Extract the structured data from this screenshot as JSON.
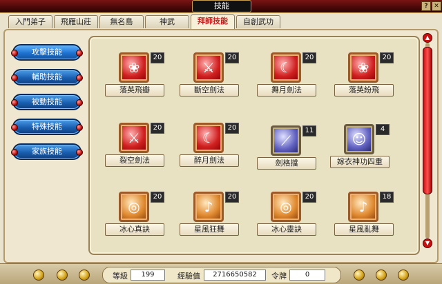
{
  "window": {
    "title": "技能"
  },
  "tabs": [
    {
      "label": "入門弟子",
      "active": false
    },
    {
      "label": "飛雁山莊",
      "active": false
    },
    {
      "label": "無名島",
      "active": false
    },
    {
      "label": "神武",
      "active": false
    },
    {
      "label": "拜師技能",
      "active": true
    },
    {
      "label": "自創武功",
      "active": false
    }
  ],
  "nav": [
    {
      "label": "攻擊技能",
      "selected": true
    },
    {
      "label": "輔助技能",
      "selected": false
    },
    {
      "label": "被動技能",
      "selected": false
    },
    {
      "label": "特殊技能",
      "selected": false
    },
    {
      "label": "家族技能",
      "selected": false
    }
  ],
  "skills": [
    {
      "name": "落英飛瓣",
      "level": "20",
      "icon": "petals-icon"
    },
    {
      "name": "斷空劍法",
      "level": "20",
      "icon": "sword-slash-icon"
    },
    {
      "name": "舞月劍法",
      "level": "20",
      "icon": "moon-sword-icon"
    },
    {
      "name": "落英紛飛",
      "level": "20",
      "icon": "petals-icon"
    },
    {
      "name": "裂空劍法",
      "level": "20",
      "icon": "sword-slash-icon"
    },
    {
      "name": "醉月劍法",
      "level": "20",
      "icon": "moon-sword-icon"
    },
    {
      "name": "劍格擋",
      "level": "11",
      "icon": "sword-block-icon"
    },
    {
      "name": "嫁衣神功四重",
      "level": "4",
      "icon": "meditation-icon"
    },
    {
      "name": "冰心真訣",
      "level": "20",
      "icon": "mirror-icon"
    },
    {
      "name": "星風狂舞",
      "level": "20",
      "icon": "dancer-icon"
    },
    {
      "name": "冰心靈訣",
      "level": "20",
      "icon": "mirror-icon"
    },
    {
      "name": "星風亂舞",
      "level": "18",
      "icon": "dancer-icon"
    }
  ],
  "stats": {
    "level_label": "等級",
    "level": "199",
    "exp_label": "經驗值",
    "exp": "2716650582",
    "token_label": "令牌",
    "token": "0"
  },
  "colors": {
    "accent_red": "#c82020",
    "nav_blue": "#1a5fb0",
    "panel": "#e8e2c2"
  }
}
